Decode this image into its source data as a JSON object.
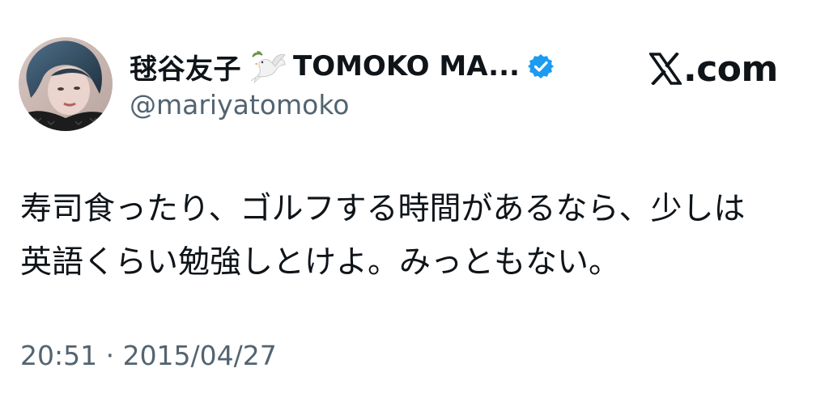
{
  "tweet": {
    "author": {
      "display_name": "毬谷友子",
      "display_name_emoji": "dove-with-olive-branch-icon",
      "display_name_latin": "TOMOKO MA...",
      "verified": true,
      "handle": "@mariyatomoko"
    },
    "brand": {
      "logo": "x-logo-icon",
      "text": ".com"
    },
    "text_lines": [
      "寿司食ったり、ゴルフする時間があるなら、少しは",
      "英語くらい勉強しとけよ。みっともない。"
    ],
    "timestamp": "20:51 · 2015/04/27"
  },
  "colors": {
    "text_primary": "#0f1419",
    "text_secondary": "#536471",
    "verified_badge": "#1d9bf0",
    "background": "#ffffff"
  }
}
